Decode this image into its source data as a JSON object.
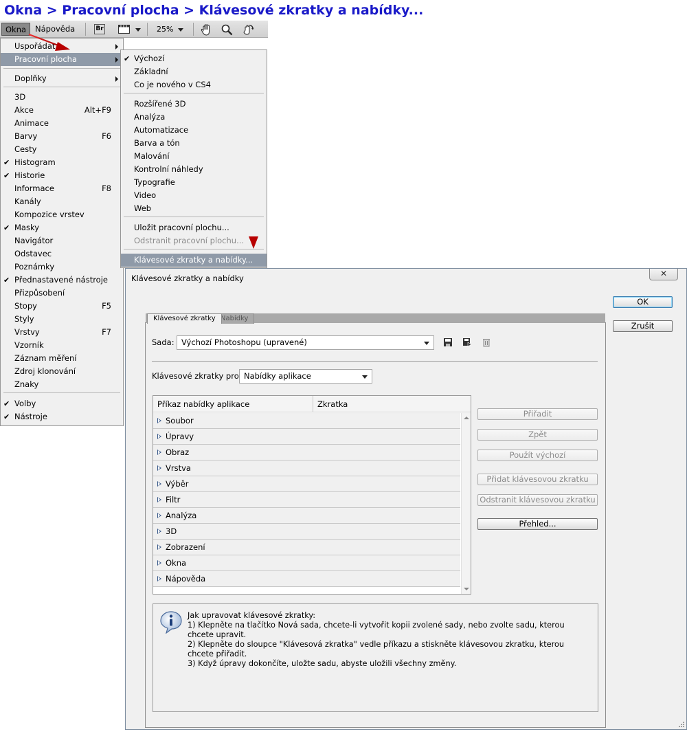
{
  "heading": "Okna > Pracovní plocha > Klávesové zkratky a nabídky...",
  "menubar": {
    "okna": "Okna",
    "napoveda": "Nápověda",
    "bridge_icon": "Br",
    "zoom": "25%"
  },
  "menu": {
    "items": [
      {
        "label": "Uspořádat",
        "shortcut": "",
        "submenu": true,
        "checked": false
      },
      {
        "label": "Pracovní plocha",
        "shortcut": "",
        "submenu": true,
        "checked": false,
        "highlighted": true
      },
      {
        "label": "Doplňky",
        "shortcut": "",
        "submenu": true,
        "checked": false
      },
      {
        "label": "3D",
        "shortcut": "",
        "checked": false
      },
      {
        "label": "Akce",
        "shortcut": "Alt+F9",
        "checked": false
      },
      {
        "label": "Animace",
        "shortcut": "",
        "checked": false
      },
      {
        "label": "Barvy",
        "shortcut": "F6",
        "checked": false
      },
      {
        "label": "Cesty",
        "shortcut": "",
        "checked": false
      },
      {
        "label": "Histogram",
        "shortcut": "",
        "checked": true
      },
      {
        "label": "Historie",
        "shortcut": "",
        "checked": true
      },
      {
        "label": "Informace",
        "shortcut": "F8",
        "checked": false
      },
      {
        "label": "Kanály",
        "shortcut": "",
        "checked": false
      },
      {
        "label": "Kompozice vrstev",
        "shortcut": "",
        "checked": false
      },
      {
        "label": "Masky",
        "shortcut": "",
        "checked": true
      },
      {
        "label": "Navigátor",
        "shortcut": "",
        "checked": false
      },
      {
        "label": "Odstavec",
        "shortcut": "",
        "checked": false
      },
      {
        "label": "Poznámky",
        "shortcut": "",
        "checked": false
      },
      {
        "label": "Přednastavené nástroje",
        "shortcut": "",
        "checked": true
      },
      {
        "label": "Přizpůsobení",
        "shortcut": "",
        "checked": false
      },
      {
        "label": "Stopy",
        "shortcut": "F5",
        "checked": false
      },
      {
        "label": "Styly",
        "shortcut": "",
        "checked": false
      },
      {
        "label": "Vrstvy",
        "shortcut": "F7",
        "checked": false
      },
      {
        "label": "Vzorník",
        "shortcut": "",
        "checked": false
      },
      {
        "label": "Záznam měření",
        "shortcut": "",
        "checked": false
      },
      {
        "label": "Zdroj klonování",
        "shortcut": "",
        "checked": false
      },
      {
        "label": "Znaky",
        "shortcut": "",
        "checked": false
      },
      {
        "label": "Volby",
        "shortcut": "",
        "checked": true
      },
      {
        "label": "Nástroje",
        "shortcut": "",
        "checked": true
      }
    ]
  },
  "submenu": {
    "items": [
      {
        "label": "Výchozí",
        "checked": true
      },
      {
        "label": "Základní"
      },
      {
        "label": "Co je nového v CS4"
      },
      {
        "label": "Rozšířené 3D"
      },
      {
        "label": "Analýza"
      },
      {
        "label": "Automatizace"
      },
      {
        "label": "Barva a tón"
      },
      {
        "label": "Malování"
      },
      {
        "label": "Kontrolní náhledy"
      },
      {
        "label": "Typografie"
      },
      {
        "label": "Video"
      },
      {
        "label": "Web"
      },
      {
        "label": "Uložit pracovní plochu..."
      },
      {
        "label": "Odstranit pracovní plochu...",
        "disabled": true
      },
      {
        "label": "Klávesové zkratky a nabídky...",
        "highlighted": true
      }
    ]
  },
  "dialog": {
    "title": "Klávesové zkratky a nabídky",
    "close": "☒",
    "ok": "OK",
    "cancel": "Zrušit",
    "tabs": [
      "Klávesové zkratky",
      "Nabídky"
    ],
    "set_label": "Sada:",
    "set_value": "Výchozí Photoshopu (upravené)",
    "shortcuts_for_label": "Klávesové zkratky pro:",
    "shortcuts_for_value": "Nabídky aplikace",
    "columns": [
      "Příkaz nabídky aplikace",
      "Zkratka"
    ],
    "rows": [
      "Soubor",
      "Úpravy",
      "Obraz",
      "Vrstva",
      "Výběr",
      "Filtr",
      "Analýza",
      "3D",
      "Zobrazení",
      "Okna",
      "Nápověda"
    ],
    "buttons": {
      "assign": "Přiřadit",
      "undo": "Zpět",
      "use_default": "Použít výchozí",
      "add_shortcut": "Přidat klávesovou zkratku",
      "remove_shortcut": "Odstranit klávesovou zkratku",
      "summary": "Přehled..."
    },
    "info_lines": [
      "Jak upravovat klávesové zkratky:",
      "1) Klepněte na tlačítko Nová sada, chcete-li vytvořit kopii zvolené sady, nebo zvolte sadu, kterou chcete upravit.",
      "2) Klepněte do sloupce \"Klávesová zkratka\" vedle příkazu a stiskněte klávesovou zkratku, kterou chcete přiřadit.",
      "3) Když úpravy dokončíte, uložte sadu, abyste uložili všechny změny."
    ]
  },
  "colors": {
    "heading": "#1a1ac8",
    "arrow": "#cc0000",
    "menu_highlight": "#8f9aa8"
  }
}
